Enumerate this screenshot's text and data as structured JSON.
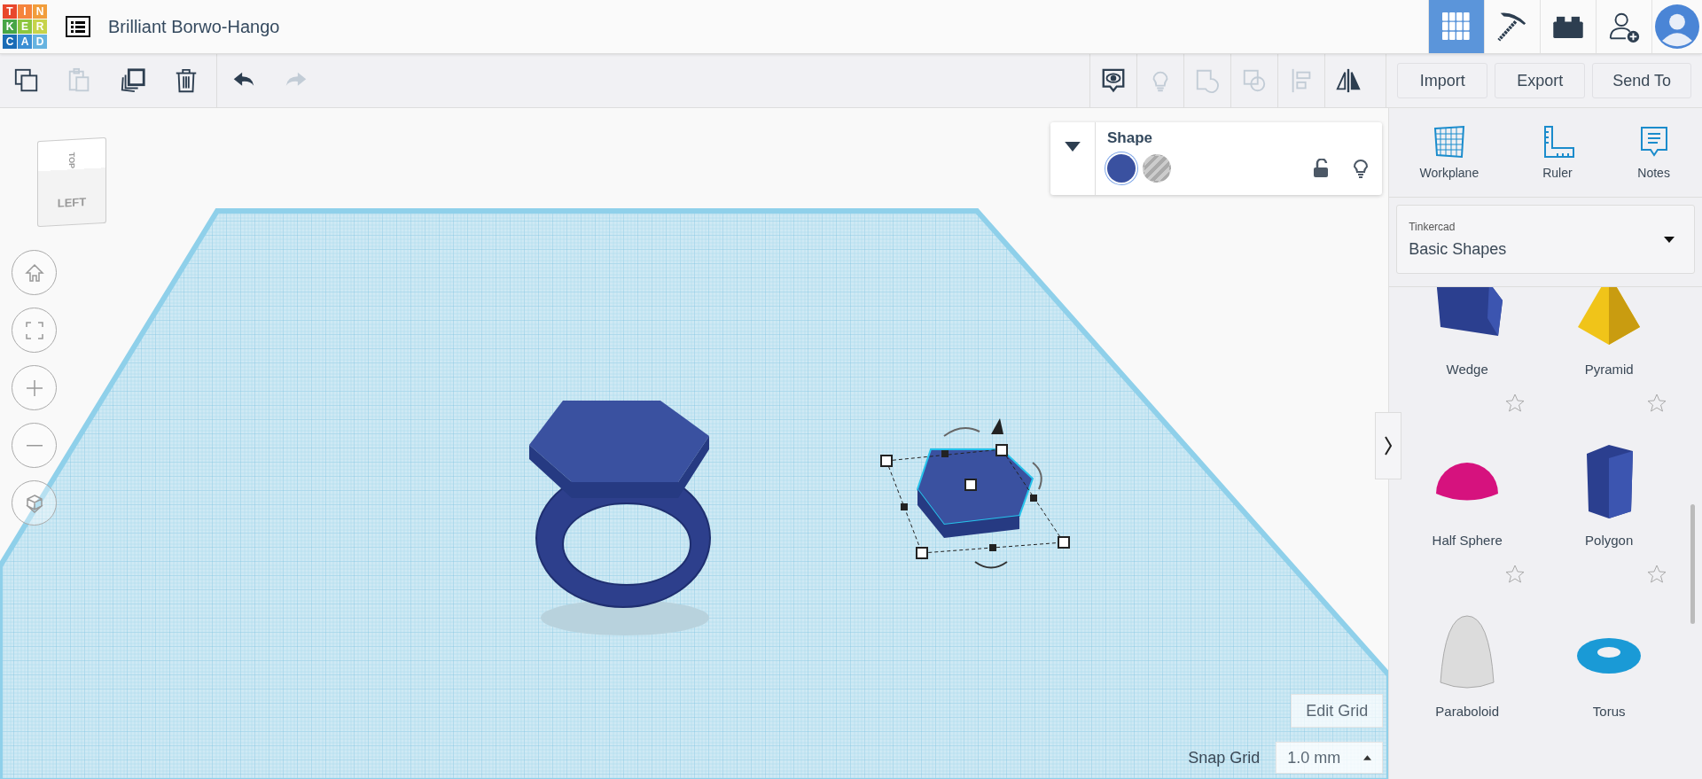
{
  "app": {
    "logo_letters": [
      "T",
      "I",
      "N",
      "K",
      "E",
      "R",
      "C",
      "A",
      "D"
    ],
    "title": "Brilliant Borwo-Hango"
  },
  "view_tabs": [
    {
      "kind": "grid",
      "selected": true
    },
    {
      "kind": "pickaxe",
      "selected": false
    },
    {
      "kind": "brick",
      "selected": false
    },
    {
      "kind": "add-user",
      "selected": false
    },
    {
      "kind": "avatar",
      "selected": false
    }
  ],
  "toolbar": {
    "left": [
      {
        "kind": "copy",
        "disabled": false
      },
      {
        "kind": "paste",
        "disabled": true
      },
      {
        "kind": "duplicate",
        "disabled": false
      },
      {
        "kind": "delete",
        "disabled": false
      },
      {
        "kind": "undo",
        "disabled": false
      },
      {
        "kind": "redo",
        "disabled": true
      }
    ],
    "right": [
      {
        "kind": "notes-view",
        "disabled": false
      },
      {
        "kind": "bulb",
        "disabled": true
      },
      {
        "kind": "group",
        "disabled": true
      },
      {
        "kind": "ungroup",
        "disabled": true
      },
      {
        "kind": "align",
        "disabled": true
      },
      {
        "kind": "mirror",
        "disabled": false
      }
    ],
    "buttons": [
      "Import",
      "Export",
      "Send To"
    ]
  },
  "view_cube": {
    "top": "TOP",
    "front": "LEFT"
  },
  "nav_buttons": [
    {
      "kind": "home"
    },
    {
      "kind": "fit"
    },
    {
      "kind": "zoom-in"
    },
    {
      "kind": "zoom-out"
    },
    {
      "kind": "ortho"
    }
  ],
  "shape_panel": {
    "title": "Shape",
    "swatches": [
      {
        "kind": "solid",
        "selected": true
      },
      {
        "kind": "hole",
        "selected": false
      }
    ]
  },
  "tools": [
    {
      "kind": "workplane",
      "label": "Workplane"
    },
    {
      "kind": "ruler",
      "label": "Ruler"
    },
    {
      "kind": "notes",
      "label": "Notes"
    }
  ],
  "library": {
    "source": "Tinkercad",
    "name": "Basic Shapes"
  },
  "shapes": [
    {
      "kind": "wedge",
      "name": "Wedge"
    },
    {
      "kind": "pyramid",
      "name": "Pyramid"
    },
    {
      "kind": "half-sphere",
      "name": "Half Sphere"
    },
    {
      "kind": "polygon",
      "name": "Polygon"
    },
    {
      "kind": "paraboloid",
      "name": "Paraboloid"
    },
    {
      "kind": "torus",
      "name": "Torus"
    }
  ],
  "edit_grid": "Edit Grid",
  "snap_grid": {
    "label": "Snap Grid",
    "value": "1.0 mm"
  }
}
